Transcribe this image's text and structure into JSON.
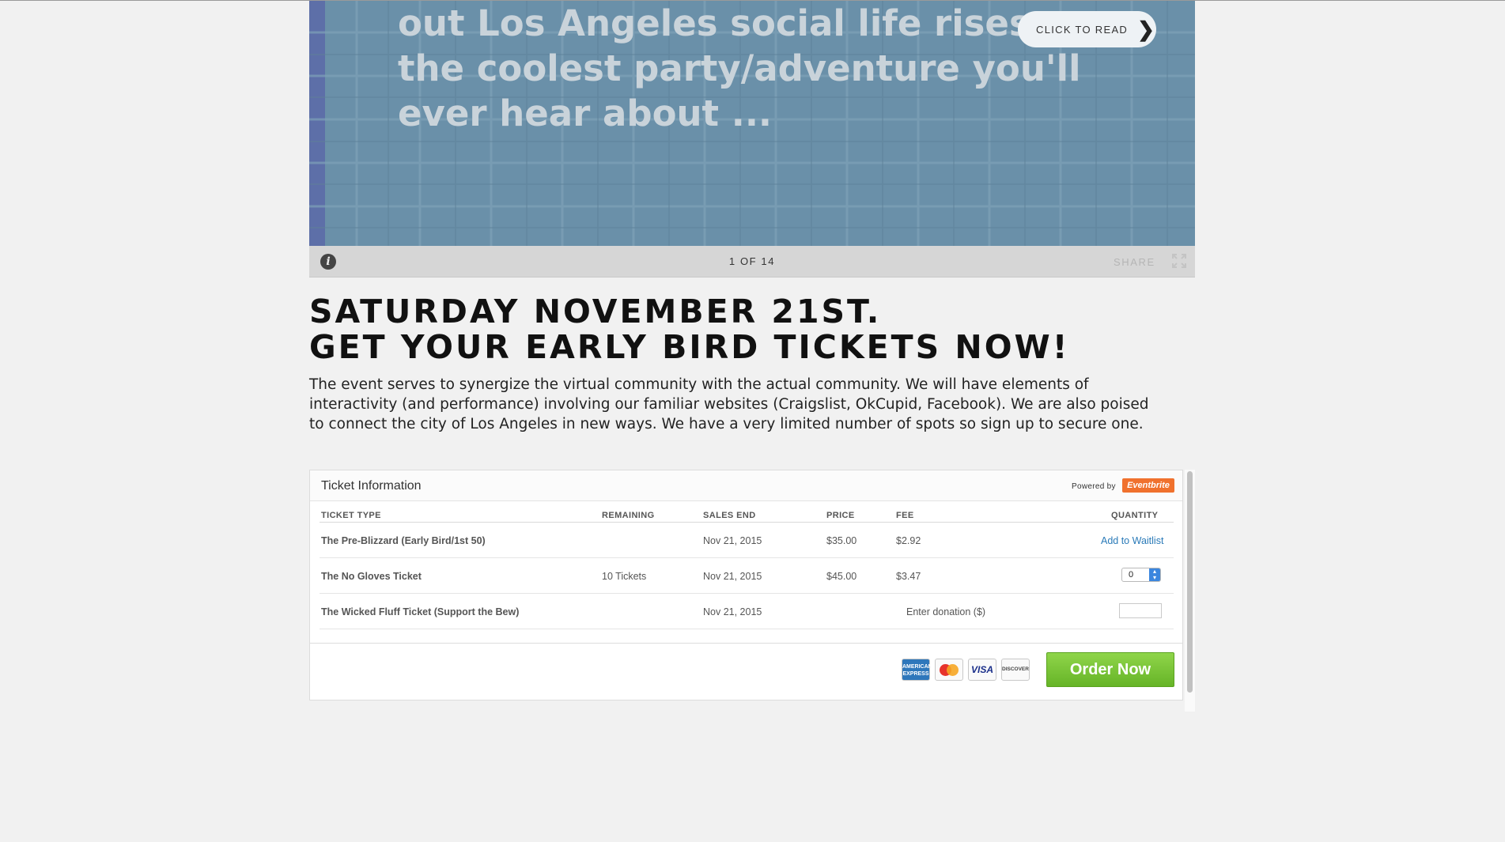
{
  "slideshow": {
    "text_lines": [
      "out Los Angeles social life rises",
      "the coolest party/adventure you'll",
      "ever hear about ..."
    ],
    "read_button": "CLICK TO READ",
    "counter": "1 OF 14",
    "share": "SHARE",
    "info_icon": "info-icon",
    "expand_icon": "expand-icon"
  },
  "headline": {
    "line1": "SATURDAY NOVEMBER 21ST.",
    "line2": "GET YOUR EARLY BIRD TICKETS NOW!"
  },
  "description": "The event serves to synergize the virtual community with the actual community.  We will have elements of interactivity (and performance) involving our familiar websites (Craigslist, OkCupid, Facebook).  We are also poised to connect the city of Los Angeles in new ways.  We have a very limited number of spots so sign up to secure one.",
  "tickets": {
    "title": "Ticket Information",
    "powered_by": "Powered by",
    "brand": "Eventbrite",
    "brand_color": "#f0712d",
    "columns": {
      "type": "TICKET TYPE",
      "remaining": "REMAINING",
      "sales_end": "SALES END",
      "price": "PRICE",
      "fee": "FEE",
      "quantity": "QUANTITY"
    },
    "rows": [
      {
        "name": "The Pre-Blizzard (Early Bird/1st 50)",
        "remaining": "",
        "sales_end": "Nov 21, 2015",
        "price": "$35.00",
        "fee": "$2.92",
        "action": "Add to Waitlist"
      },
      {
        "name": "The No Gloves Ticket",
        "remaining": "10 Tickets",
        "sales_end": "Nov 21, 2015",
        "price": "$45.00",
        "fee": "$3.47",
        "quantity": "0"
      },
      {
        "name": "The Wicked Fluff Ticket (Support the Bew)",
        "remaining": "",
        "sales_end": "Nov 21, 2015",
        "price": "",
        "fee": "",
        "donation_label": "Enter donation ($)"
      }
    ],
    "cards": {
      "amex": "AMERICAN EXPRESS",
      "visa": "VISA",
      "discover": "DISCOVER"
    },
    "order_button": "Order Now",
    "order_color": "#6fbf2e"
  }
}
